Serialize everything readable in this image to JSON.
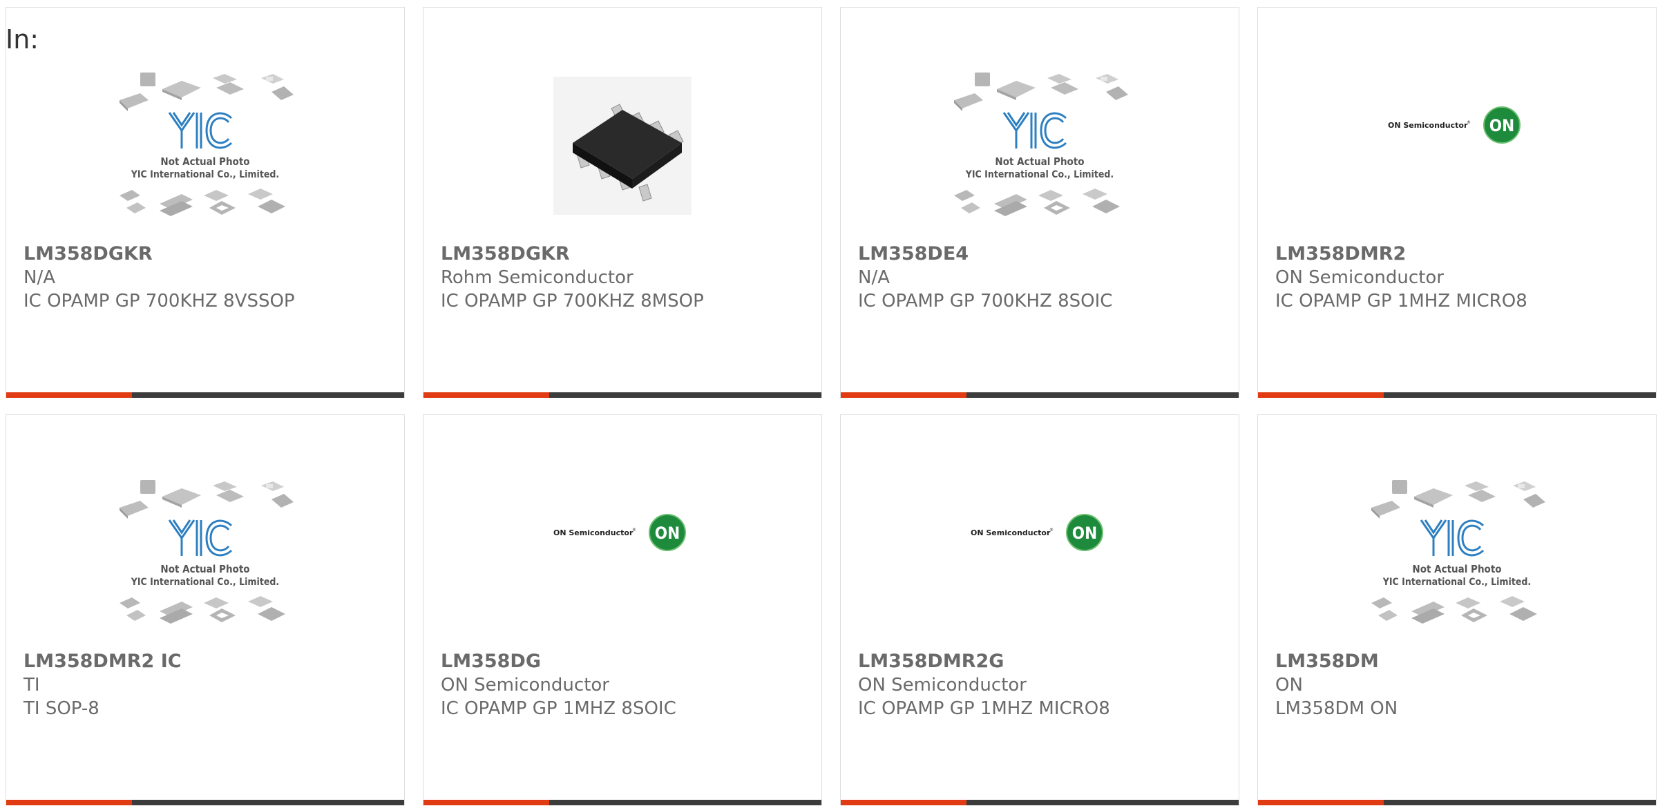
{
  "page": {
    "label": "In:",
    "colors": {
      "accent": "#e03b12",
      "bar": "#3c3c3c",
      "text": "#6a6a6a",
      "border": "#dddddd",
      "yic_blue": "#2d7fc1",
      "on_green": "#1e8a3c"
    }
  },
  "placeholder_image": {
    "brand": "YIC",
    "line1": "Not Actual Photo",
    "line2": "YIC International Co., Limited."
  },
  "on_logo": {
    "text": "ON Semiconductor",
    "mark": "ON"
  },
  "products": [
    {
      "part": "LM358DGKR",
      "manufacturer": "N/A",
      "description": "IC OPAMP GP 700KHZ 8VSSOP",
      "image": "yic-placeholder-icon"
    },
    {
      "part": "LM358DGKR",
      "manufacturer": "Rohm Semiconductor",
      "description": "IC OPAMP GP 700KHZ 8MSOP",
      "image": "chip-photo-icon"
    },
    {
      "part": "LM358DE4",
      "manufacturer": "N/A",
      "description": "IC OPAMP GP 700KHZ 8SOIC",
      "image": "yic-placeholder-icon"
    },
    {
      "part": "LM358DMR2",
      "manufacturer": "ON Semiconductor",
      "description": "IC OPAMP GP 1MHZ MICRO8",
      "image": "on-semiconductor-logo-icon"
    },
    {
      "part": "LM358DMR2 IC",
      "manufacturer": "TI",
      "description": "TI SOP-8",
      "image": "yic-placeholder-icon"
    },
    {
      "part": "LM358DG",
      "manufacturer": "ON Semiconductor",
      "description": "IC OPAMP GP 1MHZ 8SOIC",
      "image": "on-semiconductor-logo-icon"
    },
    {
      "part": "LM358DMR2G",
      "manufacturer": "ON Semiconductor",
      "description": "IC OPAMP GP 1MHZ MICRO8",
      "image": "on-semiconductor-logo-icon"
    },
    {
      "part": "LM358DM",
      "manufacturer": "ON",
      "description": "LM358DM ON",
      "image": "yic-placeholder-icon"
    }
  ]
}
